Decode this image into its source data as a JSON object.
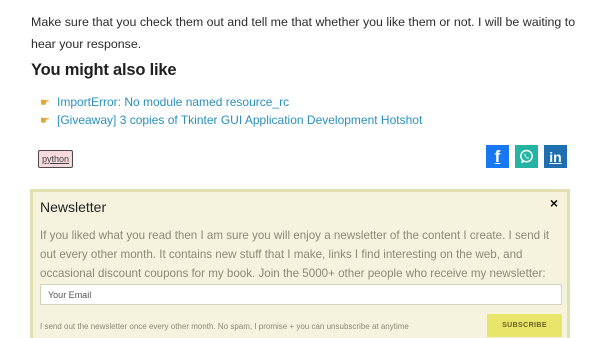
{
  "article": {
    "intro": "Make sure that you check them out and tell me that whether you like them or not. I will be waiting to hear your response."
  },
  "related": {
    "title": "You might also like",
    "items": [
      {
        "label": "ImportError: No module named resource_rc"
      },
      {
        "label": "[Giveaway] 3 copies of Tkinter GUI Application Development Hotshot"
      }
    ]
  },
  "tags": [
    {
      "label": "python"
    }
  ],
  "share": {
    "facebook": "f",
    "whatsapp": "whatsapp-icon",
    "linkedin": "in"
  },
  "newsletter": {
    "title": "Newsletter",
    "close": "×",
    "description": "If you liked what you read then I am sure you will enjoy a newsletter of the content I create. I send it out every other month. It contains new stuff that I make, links I find interesting on the web, and occasional discount coupons for my book. Join the 5000+ other people who receive my newsletter:",
    "email_placeholder": "Your Email",
    "note": "I send out the newsletter once every other month. No spam, I promise + you can unsubscribe at anytime",
    "button": "SUBSCRIBE"
  },
  "colors": {
    "link": "#2a8fbd",
    "newsletter_bg": "#f5f3dd",
    "newsletter_border": "#e2dfb1",
    "subscribe_bg": "#e8e56a",
    "facebook": "#1877f2",
    "whatsapp": "#25b4a1",
    "linkedin": "#1f6fb0"
  }
}
